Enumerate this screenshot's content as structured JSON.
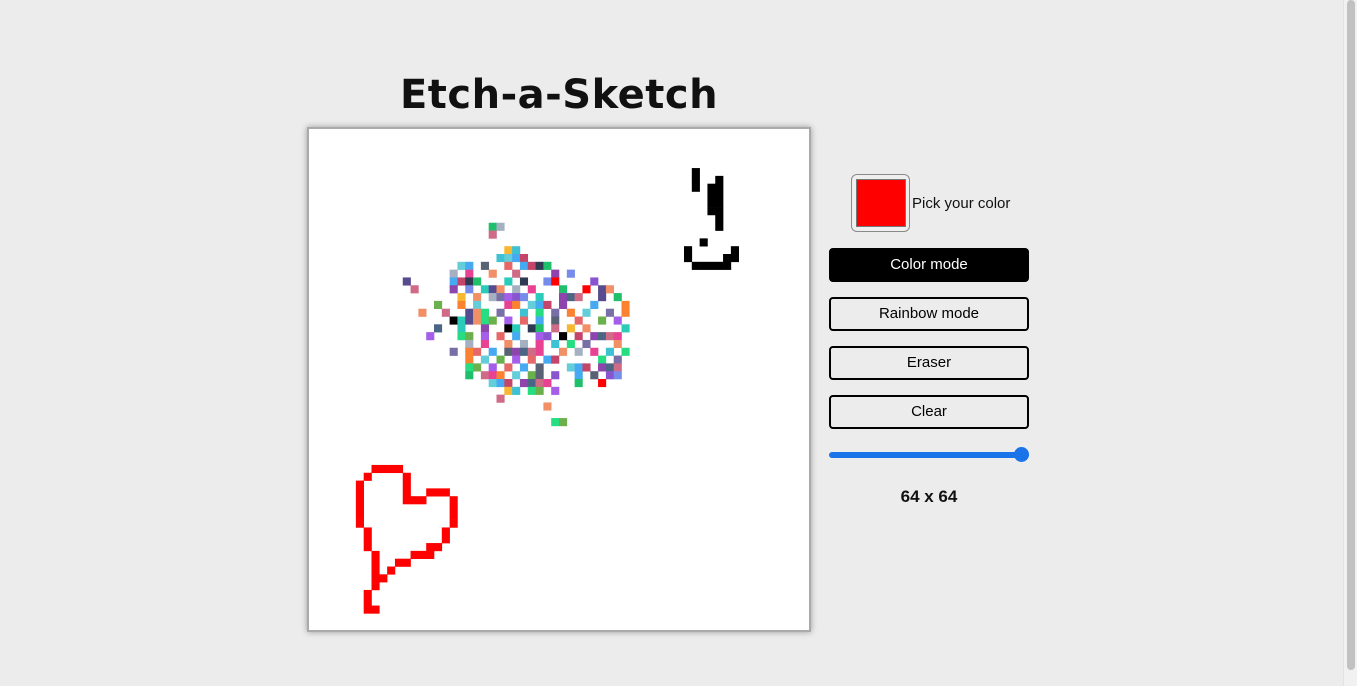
{
  "app": {
    "title": "Etch-a-Sketch"
  },
  "controls": {
    "color_picker": {
      "label": "Pick your color",
      "value": "#ff0000"
    },
    "buttons": {
      "color_mode": "Color mode",
      "rainbow_mode": "Rainbow mode",
      "eraser": "Eraser",
      "clear": "Clear"
    },
    "active_mode": "color_mode",
    "slider": {
      "min": 1,
      "max": 64,
      "value": 64
    },
    "grid_size_label": "64 x 64"
  },
  "colors": {
    "background": "#ececec",
    "board": "#ffffff",
    "accent": "#1a73e8",
    "selected_color": "#ff0000",
    "ink": "#000000"
  },
  "grid": {
    "size": 64,
    "palette": [
      "#000000",
      "#ff0000",
      "#e84393",
      "#a55eea",
      "#8e44ad",
      "#20bf6b",
      "#26de81",
      "#45aaf2",
      "#2bcbba",
      "#f7b731",
      "#fa8231",
      "#8854d0",
      "#4b6584",
      "#a5b1c2",
      "#6ab04c",
      "#c44569",
      "#574b90",
      "#3dc1d3",
      "#e66767",
      "#778beb",
      "#cf6a87",
      "#786fa6",
      "#596275",
      "#303952",
      "#f19066",
      "#63cdda"
    ],
    "red_cells": [
      [
        8,
        43
      ],
      [
        9,
        43
      ],
      [
        10,
        43
      ],
      [
        11,
        43
      ],
      [
        7,
        44
      ],
      [
        12,
        44
      ],
      [
        6,
        45
      ],
      [
        12,
        45
      ],
      [
        6,
        46
      ],
      [
        12,
        46
      ],
      [
        13,
        47
      ],
      [
        14,
        47
      ],
      [
        15,
        46
      ],
      [
        16,
        46
      ],
      [
        17,
        46
      ],
      [
        18,
        47
      ],
      [
        18,
        48
      ],
      [
        18,
        49
      ],
      [
        18,
        50
      ],
      [
        17,
        51
      ],
      [
        17,
        52
      ],
      [
        16,
        53
      ],
      [
        15,
        53
      ],
      [
        15,
        54
      ],
      [
        14,
        54
      ],
      [
        13,
        54
      ],
      [
        12,
        55
      ],
      [
        11,
        55
      ],
      [
        10,
        56
      ],
      [
        9,
        57
      ],
      [
        8,
        57
      ],
      [
        8,
        58
      ],
      [
        7,
        59
      ],
      [
        7,
        60
      ],
      [
        7,
        61
      ],
      [
        8,
        61
      ],
      [
        6,
        47
      ],
      [
        6,
        48
      ],
      [
        6,
        49
      ],
      [
        6,
        50
      ],
      [
        7,
        51
      ],
      [
        7,
        52
      ],
      [
        7,
        53
      ],
      [
        8,
        54
      ],
      [
        8,
        55
      ],
      [
        8,
        56
      ],
      [
        12,
        47
      ]
    ],
    "black_cells": [
      [
        49,
        5
      ],
      [
        49,
        6
      ],
      [
        52,
        6
      ],
      [
        49,
        7
      ],
      [
        51,
        7
      ],
      [
        52,
        7
      ],
      [
        51,
        8
      ],
      [
        52,
        8
      ],
      [
        51,
        9
      ],
      [
        52,
        9
      ],
      [
        51,
        10
      ],
      [
        52,
        10
      ],
      [
        52,
        11
      ],
      [
        52,
        12
      ],
      [
        48,
        15
      ],
      [
        48,
        16
      ],
      [
        49,
        17
      ],
      [
        50,
        17
      ],
      [
        51,
        17
      ],
      [
        52,
        17
      ],
      [
        53,
        17
      ],
      [
        53,
        16
      ],
      [
        54,
        16
      ],
      [
        54,
        15
      ],
      [
        50,
        14
      ]
    ],
    "scatter_cells": [
      [
        23,
        12
      ],
      [
        24,
        12
      ],
      [
        23,
        13
      ],
      [
        25,
        15
      ],
      [
        26,
        15
      ],
      [
        24,
        16
      ],
      [
        25,
        16
      ],
      [
        26,
        16
      ],
      [
        27,
        16
      ],
      [
        19,
        17
      ],
      [
        20,
        17
      ],
      [
        22,
        17
      ],
      [
        25,
        17
      ],
      [
        27,
        17
      ],
      [
        28,
        17
      ],
      [
        29,
        17
      ],
      [
        30,
        17
      ],
      [
        18,
        18
      ],
      [
        20,
        18
      ],
      [
        23,
        18
      ],
      [
        26,
        18
      ],
      [
        31,
        18
      ],
      [
        33,
        18
      ],
      [
        12,
        19
      ],
      [
        18,
        19
      ],
      [
        19,
        19
      ],
      [
        20,
        19
      ],
      [
        21,
        19
      ],
      [
        25,
        19
      ],
      [
        27,
        19
      ],
      [
        30,
        19
      ],
      [
        31,
        19
      ],
      [
        36,
        19
      ],
      [
        13,
        20
      ],
      [
        18,
        20
      ],
      [
        20,
        20
      ],
      [
        22,
        20
      ],
      [
        23,
        20
      ],
      [
        24,
        20
      ],
      [
        26,
        20
      ],
      [
        28,
        20
      ],
      [
        32,
        20
      ],
      [
        35,
        20
      ],
      [
        37,
        20
      ],
      [
        38,
        20
      ],
      [
        19,
        21
      ],
      [
        21,
        21
      ],
      [
        23,
        21
      ],
      [
        24,
        21
      ],
      [
        25,
        21
      ],
      [
        26,
        21
      ],
      [
        27,
        21
      ],
      [
        29,
        21
      ],
      [
        32,
        21
      ],
      [
        33,
        21
      ],
      [
        34,
        21
      ],
      [
        37,
        21
      ],
      [
        39,
        21
      ],
      [
        16,
        22
      ],
      [
        19,
        22
      ],
      [
        21,
        22
      ],
      [
        25,
        22
      ],
      [
        26,
        22
      ],
      [
        28,
        22
      ],
      [
        29,
        22
      ],
      [
        30,
        22
      ],
      [
        32,
        22
      ],
      [
        36,
        22
      ],
      [
        40,
        22
      ],
      [
        14,
        23
      ],
      [
        17,
        23
      ],
      [
        20,
        23
      ],
      [
        21,
        23
      ],
      [
        22,
        23
      ],
      [
        24,
        23
      ],
      [
        27,
        23
      ],
      [
        29,
        23
      ],
      [
        31,
        23
      ],
      [
        33,
        23
      ],
      [
        35,
        23
      ],
      [
        38,
        23
      ],
      [
        40,
        23
      ],
      [
        18,
        24
      ],
      [
        19,
        24
      ],
      [
        20,
        24
      ],
      [
        21,
        24
      ],
      [
        22,
        24
      ],
      [
        23,
        24
      ],
      [
        25,
        24
      ],
      [
        27,
        24
      ],
      [
        29,
        24
      ],
      [
        31,
        24
      ],
      [
        34,
        24
      ],
      [
        37,
        24
      ],
      [
        39,
        24
      ],
      [
        16,
        25
      ],
      [
        19,
        25
      ],
      [
        22,
        25
      ],
      [
        25,
        25
      ],
      [
        26,
        25
      ],
      [
        28,
        25
      ],
      [
        29,
        25
      ],
      [
        31,
        25
      ],
      [
        33,
        25
      ],
      [
        35,
        25
      ],
      [
        40,
        25
      ],
      [
        15,
        26
      ],
      [
        19,
        26
      ],
      [
        20,
        26
      ],
      [
        22,
        26
      ],
      [
        24,
        26
      ],
      [
        26,
        26
      ],
      [
        29,
        26
      ],
      [
        30,
        26
      ],
      [
        32,
        26
      ],
      [
        34,
        26
      ],
      [
        36,
        26
      ],
      [
        37,
        26
      ],
      [
        38,
        26
      ],
      [
        39,
        26
      ],
      [
        20,
        27
      ],
      [
        22,
        27
      ],
      [
        25,
        27
      ],
      [
        27,
        27
      ],
      [
        29,
        27
      ],
      [
        31,
        27
      ],
      [
        33,
        27
      ],
      [
        35,
        27
      ],
      [
        39,
        27
      ],
      [
        18,
        28
      ],
      [
        20,
        28
      ],
      [
        21,
        28
      ],
      [
        23,
        28
      ],
      [
        25,
        28
      ],
      [
        26,
        28
      ],
      [
        27,
        28
      ],
      [
        28,
        28
      ],
      [
        29,
        28
      ],
      [
        32,
        28
      ],
      [
        34,
        28
      ],
      [
        36,
        28
      ],
      [
        38,
        28
      ],
      [
        40,
        28
      ],
      [
        20,
        29
      ],
      [
        22,
        29
      ],
      [
        24,
        29
      ],
      [
        26,
        29
      ],
      [
        28,
        29
      ],
      [
        30,
        29
      ],
      [
        31,
        29
      ],
      [
        37,
        29
      ],
      [
        39,
        29
      ],
      [
        20,
        30
      ],
      [
        21,
        30
      ],
      [
        23,
        30
      ],
      [
        25,
        30
      ],
      [
        27,
        30
      ],
      [
        29,
        30
      ],
      [
        33,
        30
      ],
      [
        34,
        30
      ],
      [
        35,
        30
      ],
      [
        37,
        30
      ],
      [
        38,
        30
      ],
      [
        39,
        30
      ],
      [
        20,
        31
      ],
      [
        22,
        31
      ],
      [
        23,
        31
      ],
      [
        24,
        31
      ],
      [
        26,
        31
      ],
      [
        28,
        31
      ],
      [
        29,
        31
      ],
      [
        31,
        31
      ],
      [
        34,
        31
      ],
      [
        36,
        31
      ],
      [
        38,
        31
      ],
      [
        39,
        31
      ],
      [
        23,
        32
      ],
      [
        24,
        32
      ],
      [
        25,
        32
      ],
      [
        27,
        32
      ],
      [
        28,
        32
      ],
      [
        29,
        32
      ],
      [
        30,
        32
      ],
      [
        34,
        32
      ],
      [
        37,
        32
      ],
      [
        25,
        33
      ],
      [
        26,
        33
      ],
      [
        28,
        33
      ],
      [
        29,
        33
      ],
      [
        31,
        33
      ],
      [
        24,
        34
      ],
      [
        30,
        35
      ],
      [
        31,
        37
      ],
      [
        32,
        37
      ]
    ]
  }
}
